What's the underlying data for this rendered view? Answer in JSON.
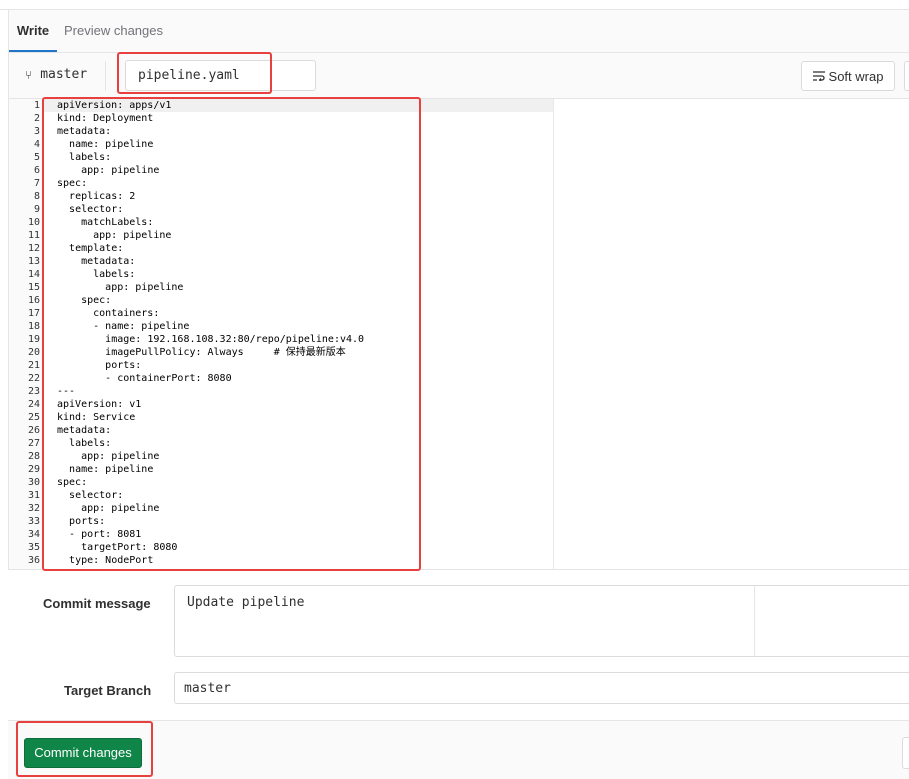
{
  "tabs": {
    "write": "Write",
    "preview": "Preview changes"
  },
  "header": {
    "branch": "master",
    "file_name": "pipeline.yaml",
    "soft_wrap": "Soft wrap"
  },
  "code_lines": [
    {
      "n": "1",
      "indent": "",
      "text": "apiVersion: apps/v1"
    },
    {
      "n": "2",
      "indent": "",
      "text": "kind: Deployment"
    },
    {
      "n": "3",
      "indent": "",
      "text": "metadata:"
    },
    {
      "n": "4",
      "indent": "  ",
      "text": "name: pipeline"
    },
    {
      "n": "5",
      "indent": "  ",
      "text": "labels:"
    },
    {
      "n": "6",
      "indent": "    ",
      "text": "app: pipeline"
    },
    {
      "n": "7",
      "indent": "",
      "text": "spec:"
    },
    {
      "n": "8",
      "indent": "  ",
      "text": "replicas: 2"
    },
    {
      "n": "9",
      "indent": "  ",
      "text": "selector:"
    },
    {
      "n": "10",
      "indent": "    ",
      "text": "matchLabels:"
    },
    {
      "n": "11",
      "indent": "      ",
      "text": "app: pipeline"
    },
    {
      "n": "12",
      "indent": "  ",
      "text": "template:"
    },
    {
      "n": "13",
      "indent": "    ",
      "text": "metadata:"
    },
    {
      "n": "14",
      "indent": "      ",
      "text": "labels:"
    },
    {
      "n": "15",
      "indent": "        ",
      "text": "app: pipeline"
    },
    {
      "n": "16",
      "indent": "    ",
      "text": "spec:"
    },
    {
      "n": "17",
      "indent": "      ",
      "text": "containers:"
    },
    {
      "n": "18",
      "indent": "      ",
      "text": "- name: pipeline"
    },
    {
      "n": "19",
      "indent": "        ",
      "text": "image: 192.168.108.32:80/repo/pipeline:v4.0"
    },
    {
      "n": "20",
      "indent": "        ",
      "text": "imagePullPolicy: Always     # 保持最新版本"
    },
    {
      "n": "21",
      "indent": "        ",
      "text": "ports:"
    },
    {
      "n": "22",
      "indent": "        ",
      "text": "- containerPort: 8080"
    },
    {
      "n": "23",
      "indent": "",
      "text": "---"
    },
    {
      "n": "24",
      "indent": "",
      "text": "apiVersion: v1"
    },
    {
      "n": "25",
      "indent": "",
      "text": "kind: Service"
    },
    {
      "n": "26",
      "indent": "",
      "text": "metadata:"
    },
    {
      "n": "27",
      "indent": "  ",
      "text": "labels:"
    },
    {
      "n": "28",
      "indent": "    ",
      "text": "app: pipeline"
    },
    {
      "n": "29",
      "indent": "  ",
      "text": "name: pipeline"
    },
    {
      "n": "30",
      "indent": "",
      "text": "spec:"
    },
    {
      "n": "31",
      "indent": "  ",
      "text": "selector:"
    },
    {
      "n": "32",
      "indent": "    ",
      "text": "app: pipeline"
    },
    {
      "n": "33",
      "indent": "  ",
      "text": "ports:"
    },
    {
      "n": "34",
      "indent": "  ",
      "text": "- port: 8081"
    },
    {
      "n": "35",
      "indent": "    ",
      "text": "targetPort: 8080"
    },
    {
      "n": "36",
      "indent": "  ",
      "text": "type: NodePort"
    }
  ],
  "form": {
    "commit_message_label": "Commit message",
    "commit_message_value": "Update pipeline",
    "target_branch_label": "Target Branch",
    "target_branch_value": "master"
  },
  "footer": {
    "commit_button": "Commit changes"
  },
  "colors": {
    "highlight": "#e8403f",
    "commit_button": "#108548",
    "active_tab": "#1f75cb"
  }
}
